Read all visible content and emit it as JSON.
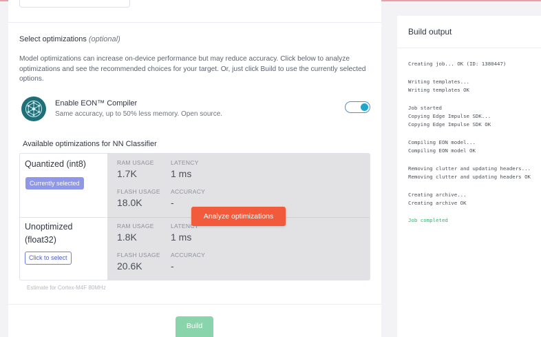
{
  "optimizations": {
    "title": "Select optimizations",
    "title_optional": "(optional)",
    "description": "Model optimizations can increase on-device performance but may reduce accuracy. Click below to analyze optimizations and see the recommended choices for your target. Or, just click Build to use the currently selected options.",
    "eon": {
      "title": "Enable EON™ Compiler",
      "subtitle": "Same accuracy, up to 50% less memory. Open source.",
      "enabled": true,
      "icon": "eon-compiler-icon"
    },
    "available_title": "Available optimizations for NN Classifier",
    "metric_labels": {
      "ram": "RAM USAGE",
      "latency": "LATENCY",
      "flash": "FLASH USAGE",
      "accuracy": "ACCURACY"
    },
    "options": [
      {
        "name": "Quantized (int8)",
        "badge": "Currently selected",
        "ram": "1.7K",
        "latency": "1 ms",
        "flash": "18.0K",
        "accuracy": "-"
      },
      {
        "name_line1": "Unoptimized",
        "name_line2": "(float32)",
        "badge": "Click to select",
        "ram": "1.8K",
        "latency": "1 ms",
        "flash": "20.6K",
        "accuracy": "-"
      }
    ],
    "analyze_button": "Analyze optimizations",
    "estimate_note": "Estimate for Cortex-M4F 80MHz",
    "build_button": "Build"
  },
  "build_output": {
    "title": "Build output",
    "log": [
      [
        "Creating job... OK (ID: 1380447)"
      ],
      [
        "Writing templates...",
        "Writing templates OK"
      ],
      [
        "Job started",
        "Copying Edge Impulse SDK...",
        "Copying Edge Impulse SDK OK"
      ],
      [
        "Compiling EON model...",
        "Compiling EON model OK"
      ],
      [
        "Removing clutter and updating headers...",
        "Removing clutter and updating headers OK"
      ],
      [
        "Creating archive...",
        "Creating archive OK"
      ]
    ],
    "final": "Job completed"
  },
  "colors": {
    "accent_orange": "#f25a3c",
    "build_green": "#89d4ab",
    "badge_selected": "#8f97e8",
    "toggle_knob": "#1fa6c9",
    "log_success": "#2bb56b"
  }
}
